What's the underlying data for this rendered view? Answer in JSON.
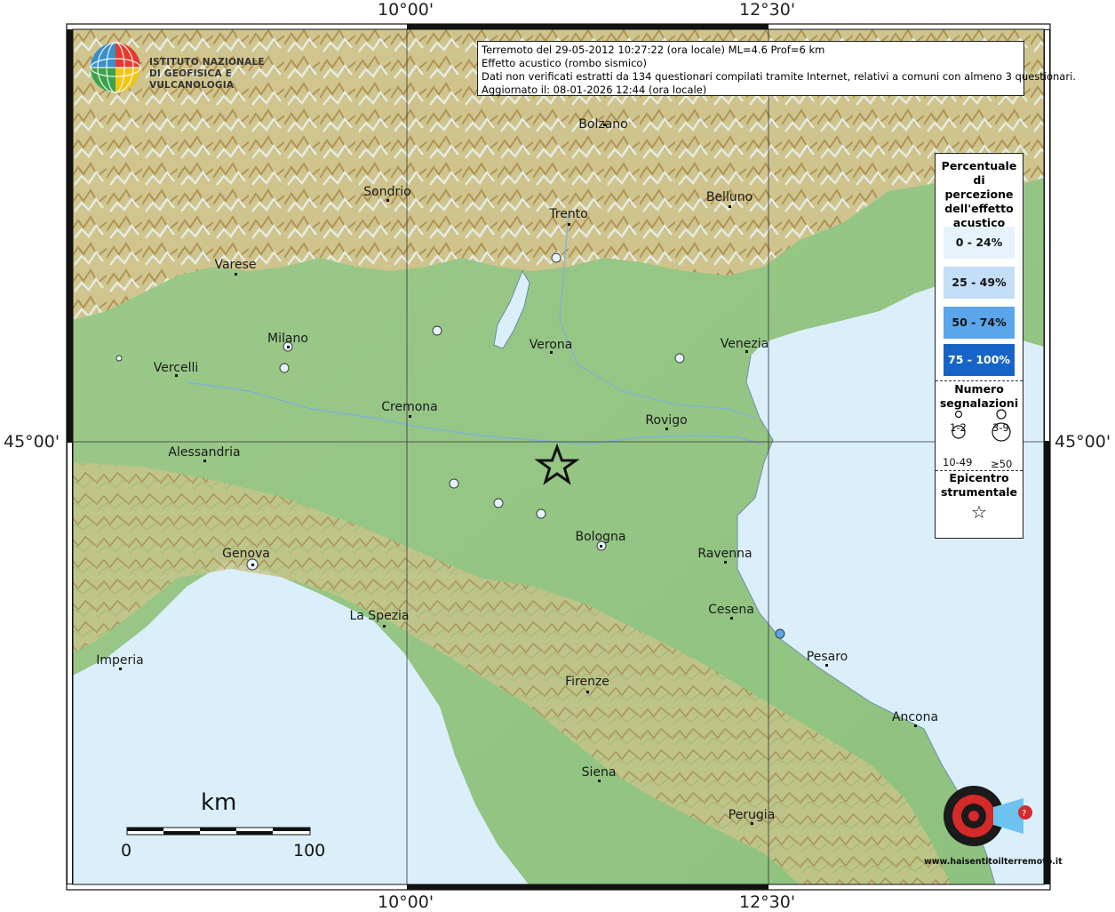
{
  "info_box": {
    "line1": "Terremoto del 29-05-2012 10:27:22 (ora locale) ML=4.6 Prof=6 km",
    "line2": "Effetto acustico (rombo sismico)",
    "line3": "Dati non verificati estratti da 134 questionari compilati tramite Internet, relativi a comuni con almeno 3 questionari.",
    "line4": "Aggiornato il: 08-01-2026 12:44 (ora locale)"
  },
  "coords": {
    "lon_left": "10°00'",
    "lon_right": "12°30'",
    "lat": "45°00'"
  },
  "logo": {
    "line1": "ISTITUTO NAZIONALE",
    "line2": "DI GEOFISICA E VULCANOLOGIA"
  },
  "legend": {
    "title": "Percentuale di percezione dell'effetto acustico",
    "classes": [
      {
        "label": "0 - 24%",
        "color": "#e6f3fd",
        "text_color": "#111111"
      },
      {
        "label": "25 - 49%",
        "color": "#c3def7",
        "text_color": "#111111"
      },
      {
        "label": "50 - 74%",
        "color": "#5ba6ea",
        "text_color": "#111111"
      },
      {
        "label": "75 - 100%",
        "color": "#1764c8",
        "text_color": "#ffffff"
      }
    ],
    "count_title": "Numero segnalazioni",
    "count_labels": [
      "1-2",
      "3-9",
      "10-49",
      "≥50"
    ],
    "epicenter_title": "Epicentro strumentale",
    "star": "☆"
  },
  "cities": [
    {
      "name": "Bolzano"
    },
    {
      "name": "Sondrio"
    },
    {
      "name": "Trento"
    },
    {
      "name": "Belluno"
    },
    {
      "name": "Varese"
    },
    {
      "name": "Milano"
    },
    {
      "name": "Verona"
    },
    {
      "name": "Venezia"
    },
    {
      "name": "Vercelli"
    },
    {
      "name": "Cremona"
    },
    {
      "name": "Rovigo"
    },
    {
      "name": "Alessandria"
    },
    {
      "name": "Bologna"
    },
    {
      "name": "Ravenna"
    },
    {
      "name": "Genova"
    },
    {
      "name": "Cesena"
    },
    {
      "name": "La Spezia"
    },
    {
      "name": "Pesaro"
    },
    {
      "name": "Imperia"
    },
    {
      "name": "Firenze"
    },
    {
      "name": "Ancona"
    },
    {
      "name": "Siena"
    },
    {
      "name": "Perugia"
    }
  ],
  "observations": [
    {
      "class": 0
    },
    {
      "class": 0
    },
    {
      "class": 0
    },
    {
      "class": 0
    },
    {
      "class": 0
    },
    {
      "class": 0
    },
    {
      "class": 0
    },
    {
      "class": 0
    },
    {
      "class": 0
    },
    {
      "class": 0
    },
    {
      "class": 0
    },
    {
      "class": 2
    }
  ],
  "scale": {
    "title": "km",
    "min": "0",
    "max": "100"
  },
  "watermark": {
    "text": "www.haisentitoilterremoto.it"
  }
}
